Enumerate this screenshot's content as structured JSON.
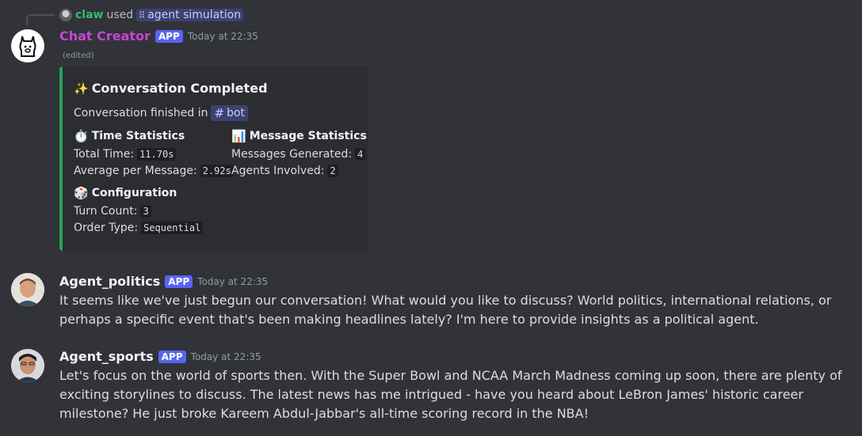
{
  "reply": {
    "user": "claw",
    "used": "used",
    "command": "agent simulation",
    "command_icon": "apps-icon"
  },
  "creator_message": {
    "username": "Chat Creator",
    "badge": "APP",
    "timestamp": "Today at 22:35",
    "edited": "(edited)",
    "embed": {
      "accent_color": "#23a559",
      "title_emoji": "✨",
      "title": "Conversation Completed",
      "desc_prefix": "Conversation finished in",
      "channel": "bot",
      "time_stats": {
        "emoji": "⏱️",
        "title": "Time Statistics",
        "total_label": "Total Time:",
        "total_value": "11.70s",
        "avg_label": "Average per Message:",
        "avg_value": "2.92s"
      },
      "message_stats": {
        "emoji": "📊",
        "title": "Message Statistics",
        "generated_label": "Messages Generated:",
        "generated_value": "4",
        "agents_label": "Agents Involved:",
        "agents_value": "2"
      },
      "configuration": {
        "emoji": "🎲",
        "title": "Configuration",
        "turn_label": "Turn Count:",
        "turn_value": "3",
        "order_label": "Order Type:",
        "order_value": "Sequential"
      }
    }
  },
  "politics_message": {
    "username": "Agent_politics",
    "badge": "APP",
    "timestamp": "Today at 22:35",
    "text": "It seems like we've just begun our conversation! What would you like to discuss? World politics, international relations, or perhaps a specific event that's been making headlines lately? I'm here to provide insights as a political agent."
  },
  "sports_message": {
    "username": "Agent_sports",
    "badge": "APP",
    "timestamp": "Today at 22:35",
    "text": "Let's focus on the world of sports then. With the Super Bowl and NCAA March Madness coming up soon, there are plenty of exciting storylines to discuss. The latest news has me intrigued - have you heard about LeBron James' historic career milestone? He just broke Kareem Abdul-Jabbar's all-time scoring record in the NBA!"
  }
}
